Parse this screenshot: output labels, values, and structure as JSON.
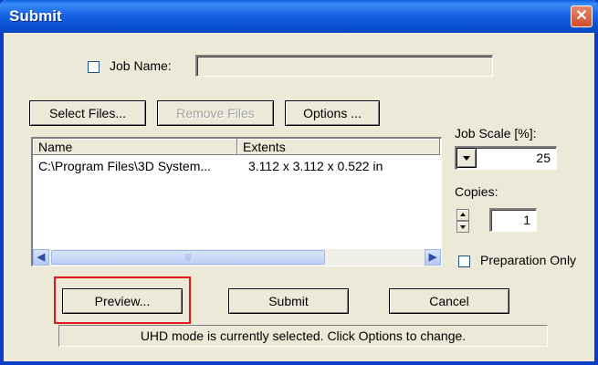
{
  "window": {
    "title": "Submit",
    "close_symbol": "✕"
  },
  "job_name": {
    "label": "Job Name:",
    "checked": false,
    "value": ""
  },
  "toolbar": {
    "select_files_label": "Select Files...",
    "remove_files_label": "Remove Files",
    "options_label": "Options ..."
  },
  "file_list": {
    "columns": [
      "Name",
      "Extents"
    ],
    "rows": [
      {
        "name": "C:\\Program Files\\3D System...",
        "extents": "3.112 x 3.112 x 0.522 in"
      }
    ],
    "scroll_thumb_grip": "|||"
  },
  "job_scale": {
    "label": "Job Scale [%]:",
    "value": "25"
  },
  "copies": {
    "label": "Copies:",
    "value": "1"
  },
  "preparation_only": {
    "label": "Preparation Only",
    "checked": false
  },
  "actions": {
    "preview_label": "Preview...",
    "submit_label": "Submit",
    "cancel_label": "Cancel"
  },
  "status": {
    "message": "UHD mode is currently selected. Click Options to change."
  },
  "colors": {
    "titlebar": "#0a5fe0",
    "highlight": "#e01818",
    "dialog_bg": "#ece9d8"
  },
  "icons": {
    "close": "close-icon",
    "scroll_left": "arrow-left-icon",
    "scroll_right": "arrow-right-icon",
    "dropdown": "chevron-down-icon"
  }
}
